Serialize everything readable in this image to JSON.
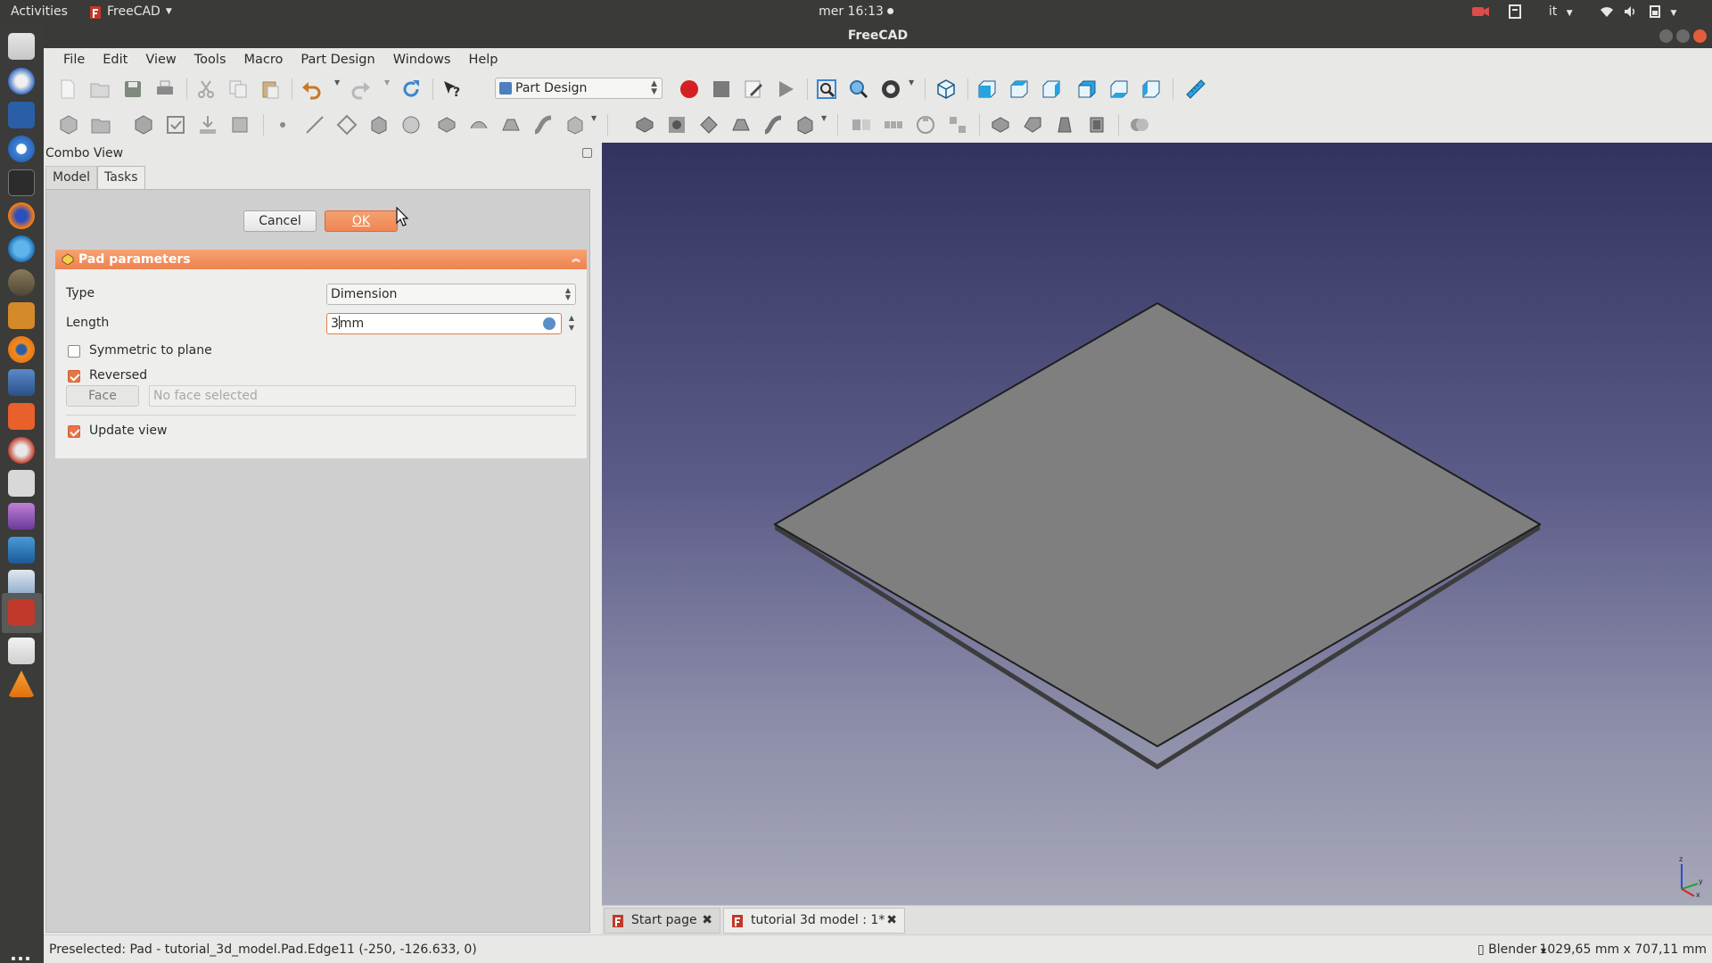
{
  "topbar": {
    "activities": "Activities",
    "app_name": "FreeCAD",
    "clock": "mer 16:13",
    "language": "it"
  },
  "window": {
    "title": "FreeCAD"
  },
  "menubar": {
    "items": [
      "File",
      "Edit",
      "View",
      "Tools",
      "Macro",
      "Part Design",
      "Windows",
      "Help"
    ]
  },
  "toolbar": {
    "workbench": "Part Design"
  },
  "combo_view": {
    "title": "Combo View",
    "tabs": [
      "Model",
      "Tasks"
    ],
    "active_tab": "Tasks",
    "cancel_label": "Cancel",
    "ok_label": "OK"
  },
  "pad_parameters": {
    "header": "Pad parameters",
    "type_label": "Type",
    "type_value": "Dimension",
    "length_label": "Length",
    "length_value_before_caret": "3",
    "length_value_after_caret": "mm",
    "symmetric_label": "Symmetric to plane",
    "symmetric_checked": false,
    "reversed_label": "Reversed",
    "reversed_checked": true,
    "face_button": "Face",
    "face_placeholder": "No face selected",
    "update_view_label": "Update view",
    "update_view_checked": true
  },
  "doc_tabs": [
    {
      "label": "Start page",
      "active": false
    },
    {
      "label": "tutorial 3d model : 1*",
      "active": true
    }
  ],
  "statusbar": {
    "message": "Preselected: Pad - tutorial_3d_model.Pad.Edge11 (-250, -126.633, 0)",
    "navigation_style": "Blender",
    "dimensions": "1029,65 mm x 707,11 mm"
  },
  "colors": {
    "accent_orange": "#ef8654",
    "view_top": "#33335f",
    "view_bottom": "#a7a8b8",
    "plate_face": "#7f7f7f"
  }
}
